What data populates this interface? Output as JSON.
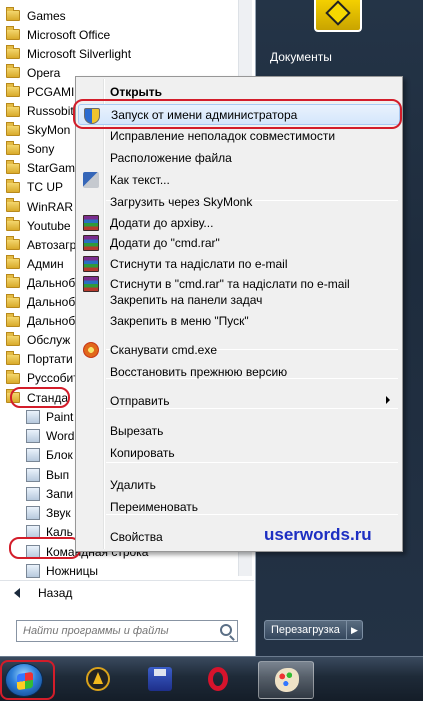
{
  "programs": {
    "folders": [
      "Games",
      "Microsoft Office",
      "Microsoft Silverlight",
      "Opera",
      "PCGAMI",
      "Russobit",
      "SkyMon",
      "Sony",
      "StarGam",
      "TC UP",
      "WinRAR",
      "Youtube",
      "Автозагр",
      "Админ",
      "Дальноб",
      "Дальноб",
      "Дальноб",
      "Обслуж",
      "Портати",
      "Руссобит",
      "Станда"
    ],
    "accessories": [
      "Paint",
      "Word",
      "Блок",
      "Вып",
      "Запи",
      "Звук",
      "Каль",
      "Командная строка",
      "Ножницы"
    ],
    "back_label": "Назад",
    "search_placeholder": "Найти программы и файлы"
  },
  "right_panel": {
    "documents_label": "Документы",
    "restart_label": "Перезагрузка",
    "restart_arrow": "▶"
  },
  "context_menu": {
    "items": [
      {
        "label": "Открыть",
        "icon": "none",
        "bold": true
      },
      {
        "label": "Запуск от имени администратора",
        "icon": "uac-shield-icon",
        "highlight": true
      },
      {
        "label": "Исправление неполадок совместимости",
        "icon": "none"
      },
      {
        "label": "Расположение файла",
        "icon": "none"
      },
      {
        "label": "Как текст...",
        "icon": "tools-icon"
      },
      {
        "label": "Загрузить через SkyMonk",
        "icon": "none"
      },
      {
        "label": "Додати до архіву...",
        "icon": "winrar-icon"
      },
      {
        "label": "Додати до \"cmd.rar\"",
        "icon": "winrar-icon"
      },
      {
        "label": "Стиснути та надіслати по e-mail",
        "icon": "winrar-icon"
      },
      {
        "label": "Стиснути в \"cmd.rar\" та надіслати по e-mail",
        "icon": "winrar-icon"
      },
      {
        "label": "Закрепить на панели задач",
        "icon": "none"
      },
      {
        "label": "Закрепить в меню \"Пуск\"",
        "icon": "none"
      },
      {
        "label": "Сканувати cmd.exe",
        "icon": "antivirus-icon"
      },
      {
        "label": "Восстановить прежнюю версию",
        "icon": "none"
      },
      {
        "label": "Отправить",
        "icon": "none",
        "submenu": true
      },
      {
        "label": "Вырезать",
        "icon": "none"
      },
      {
        "label": "Копировать",
        "icon": "none"
      },
      {
        "label": "Удалить",
        "icon": "none"
      },
      {
        "label": "Переименовать",
        "icon": "none"
      },
      {
        "label": "Свойства",
        "icon": "none"
      }
    ]
  },
  "watermark": "userwords.ru",
  "taskbar": {
    "apps": [
      "aimp-icon",
      "disk-icon",
      "opera-icon",
      "paint-icon"
    ],
    "active_app": "paint-icon"
  },
  "colors": {
    "highlight_ring": "#d31d2a",
    "watermark": "#1d2fc2",
    "taskbar": "#1e2a38"
  }
}
